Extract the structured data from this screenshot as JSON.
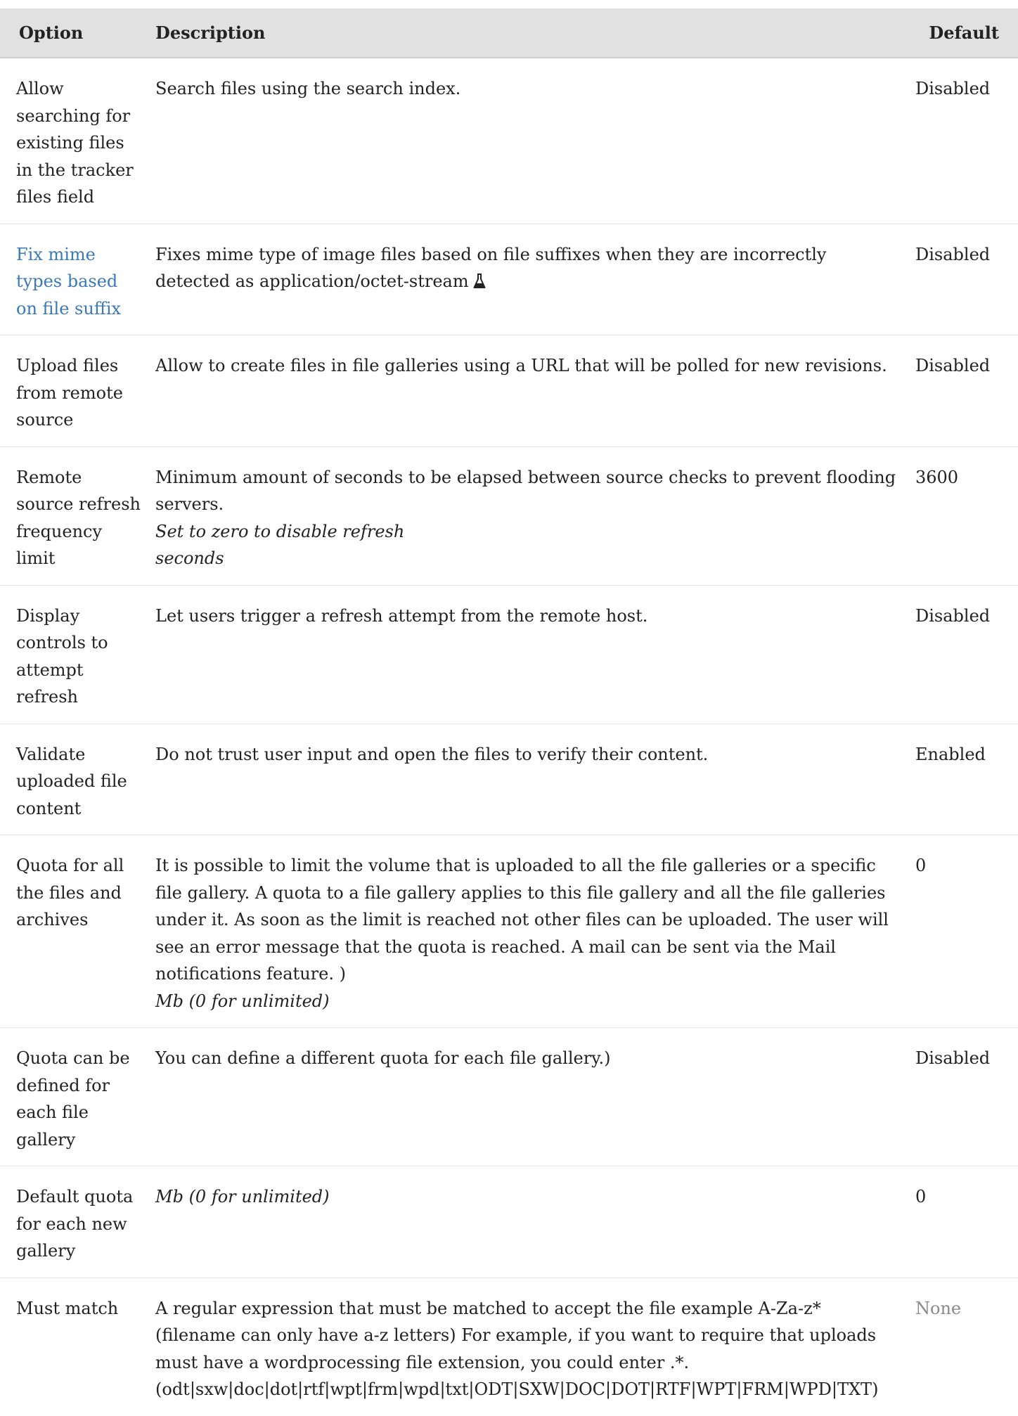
{
  "headers": {
    "option": "Option",
    "description": "Description",
    "default": "Default"
  },
  "rows": [
    {
      "option": "Allow searching for existing files in the tracker files field",
      "description": "Search files using the search index.",
      "default": "Disabled"
    },
    {
      "option": "Fix mime types based on file suffix",
      "option_is_link": true,
      "description": "Fixes mime type of image files based on file suffixes when they are incorrectly detected as application/octet-stream",
      "description_icon": "experimental-flask-icon",
      "default": "Disabled"
    },
    {
      "option": "Upload files from remote source",
      "description": "Allow to create files in file galleries using a URL that will be polled for new revisions.",
      "default": "Disabled"
    },
    {
      "option": "Remote source refresh frequency limit",
      "description": "Minimum amount of seconds to be elapsed between source checks to prevent flooding servers.",
      "notes": [
        "Set to zero to disable refresh",
        "seconds"
      ],
      "default": "3600"
    },
    {
      "option": "Display controls to attempt refresh",
      "description": "Let users trigger a refresh attempt from the remote host.",
      "default": "Disabled"
    },
    {
      "option": "Validate uploaded file content",
      "description": "Do not trust user input and open the files to verify their content.",
      "default": "Enabled"
    },
    {
      "option": "Quota for all the files and archives",
      "description": "It is possible to limit the volume that is uploaded to all the file galleries or a specific file gallery. A quota to a file gallery applies to this file gallery and all the file galleries under it. As soon as the limit is reached not other files can be uploaded. The user will see an error message that the quota is reached. A mail can be sent via the Mail notifications feature. )",
      "notes": [
        "Mb (0 for unlimited)"
      ],
      "default": "0"
    },
    {
      "option": "Quota can be defined for each file gallery",
      "description": "You can define a different quota for each file gallery.)",
      "default": "Disabled"
    },
    {
      "option": "Default quota for each new gallery",
      "description": "",
      "notes": [
        "Mb (0 for unlimited)"
      ],
      "default": "0"
    },
    {
      "option": "Must match",
      "description": "A regular expression that must be matched to accept the file example A-Za-z* (filename can only have a-z letters) For example, if you want to require that uploads must have a wordprocessing file extension, you could enter .*.(odt|sxw|doc|dot|rtf|wpt|frm|wpd|txt|ODT|SXW|DOC|DOT|RTF|WPT|FRM|WPD|TXT)",
      "default": "None",
      "default_muted": true
    }
  ],
  "colors": {
    "header_bg": "#e1e1e1",
    "link": "#3a79b8",
    "muted": "#8a8a8a",
    "text": "#222222"
  }
}
